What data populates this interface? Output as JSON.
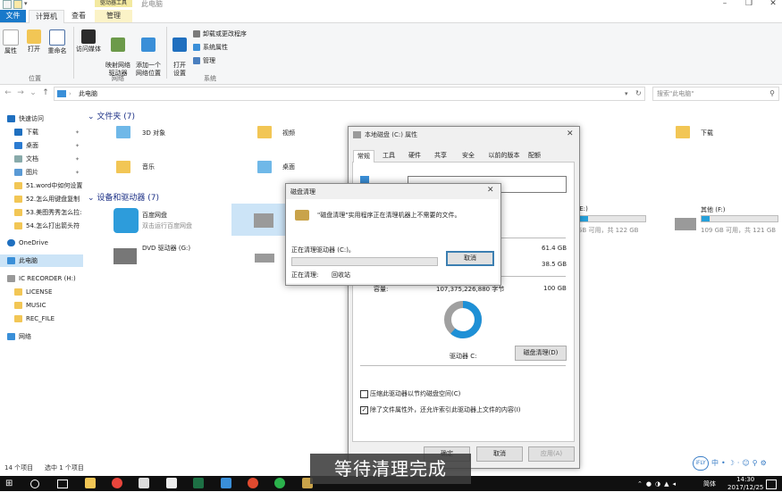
{
  "window": {
    "title": "此电脑",
    "tool_tab_header": "驱动器工具",
    "controls": [
      "–",
      "❐",
      "✕"
    ]
  },
  "tabs": [
    {
      "label": "文件"
    },
    {
      "label": "计算机"
    },
    {
      "label": "查看"
    },
    {
      "label": "管理"
    }
  ],
  "ribbon": {
    "location_buttons": [
      "属性",
      "打开",
      "重命名"
    ],
    "location_group": "位置",
    "network_buttons": [
      "访问媒体",
      "映射网络\n驱动器",
      "添加一个\n网络位置"
    ],
    "network_group": "网络",
    "system_button": "打开\n设置",
    "system_items": [
      "卸载或更改程序",
      "系统属性",
      "管理"
    ],
    "system_group": "系统"
  },
  "address": {
    "path": "此电脑",
    "search_placeholder": "搜索\"此电脑\""
  },
  "sidebar": {
    "items": [
      {
        "label": "快速访问",
        "icon": "star-icon",
        "pinned": false
      },
      {
        "label": "下载",
        "icon": "download-icon",
        "pinned": true
      },
      {
        "label": "桌面",
        "icon": "desktop-icon",
        "pinned": true
      },
      {
        "label": "文档",
        "icon": "document-icon",
        "pinned": true
      },
      {
        "label": "图片",
        "icon": "picture-icon",
        "pinned": true
      },
      {
        "label": "51.word中如何设置",
        "icon": "folder-icon",
        "pinned": false
      },
      {
        "label": "52.怎么用键盘复制",
        "icon": "folder-icon",
        "pinned": false
      },
      {
        "label": "53.美图秀秀怎么拉:",
        "icon": "folder-icon",
        "pinned": false
      },
      {
        "label": "54.怎么打出箭头符",
        "icon": "folder-icon",
        "pinned": false
      },
      {
        "label": "OneDrive",
        "icon": "cloud-icon",
        "pinned": false
      },
      {
        "label": "此电脑",
        "icon": "computer-icon",
        "pinned": false
      },
      {
        "label": "IC RECORDER (H:)",
        "icon": "drive-icon",
        "pinned": false
      },
      {
        "label": "LICENSE",
        "icon": "folder-icon",
        "pinned": false
      },
      {
        "label": "MUSIC",
        "icon": "folder-icon",
        "pinned": false
      },
      {
        "label": "REC_FILE",
        "icon": "folder-icon",
        "pinned": false
      },
      {
        "label": "网络",
        "icon": "network-icon",
        "pinned": false
      }
    ]
  },
  "content": {
    "folders_header": "文件夹 (7)",
    "folders": [
      "3D 对象",
      "视频",
      "下载",
      "音乐",
      "桌面"
    ],
    "devices_header": "设备和驱动器 (7)",
    "baidu_name": "百度网盘",
    "baidu_sub": "双击运行百度网盘",
    "dvd_name": "DVD 驱动器 (G:)",
    "drive_e_label": ":E:)",
    "drive_e_free": "GB 可用，共 122 GB",
    "drive_e_fill": 0.15,
    "drive_f_name": "其他 (F:)",
    "drive_f_free": "109 GB 可用，共 121 GB",
    "drive_f_fill": 0.1
  },
  "status": {
    "items": "14 个项目",
    "selected": "选中 1 个项目"
  },
  "properties": {
    "title": "本地磁盘 (C:) 属性",
    "tabs": [
      "常规",
      "工具",
      "硬件",
      "共享",
      "安全",
      "以前的版本",
      "配额"
    ],
    "used_value": "61.4 GB",
    "free_value": "38.5 GB",
    "capacity_label": "容量:",
    "capacity_bytes": "107,375,226,880 字节",
    "capacity_gb": "100 GB",
    "drive_label": "驱动器 C:",
    "cleanup_button": "磁盘清理(D)",
    "compress_label": "压缩此驱动器以节约磁盘空间(C)",
    "compress_checked": false,
    "index_label": "除了文件属性外，还允许索引此驱动器上文件的内容(I)",
    "index_checked": true,
    "ok": "确定",
    "cancel": "取消",
    "apply": "应用(A)",
    "used_fraction": 0.614,
    "used_color": "#1e90d6",
    "free_color": "#a0a0a0"
  },
  "cleanup": {
    "title": "磁盘清理",
    "message": "\"磁盘清理\"实用程序正在清理机器上不需要的文件。",
    "cleaning_drive": "正在清理驱动器 (C:)。",
    "cancel": "取消",
    "current_label": "正在清理:",
    "current_item": "回收站",
    "progress": 0
  },
  "taskbar": {
    "time": "14:30",
    "date": "2017/12/25",
    "ime": "中",
    "lang": "简体"
  },
  "caption": "等待清理完成"
}
